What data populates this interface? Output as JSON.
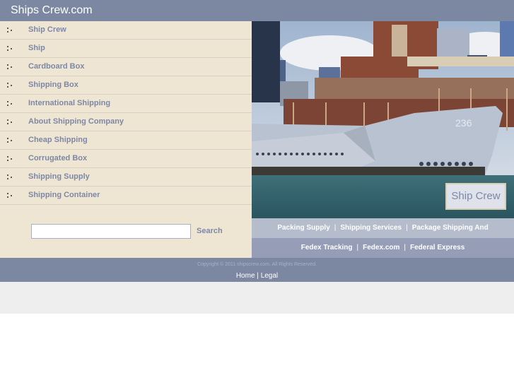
{
  "header": {
    "title": "Ships Crew.com"
  },
  "sidebar": {
    "items": [
      {
        "label": "Ship Crew"
      },
      {
        "label": "Ship"
      },
      {
        "label": "Cardboard Box"
      },
      {
        "label": "Shipping Box"
      },
      {
        "label": "International Shipping"
      },
      {
        "label": "About Shipping Company"
      },
      {
        "label": "Cheap Shipping"
      },
      {
        "label": "Corrugated Box"
      },
      {
        "label": "Shipping Supply"
      },
      {
        "label": "Shipping Container"
      }
    ],
    "bullet_icon": "dotted-bullet-icon",
    "search": {
      "value": "",
      "placeholder": "",
      "button_label": "Search"
    }
  },
  "photo": {
    "description": "Grey submarine with hull number 236 docked at a city pier",
    "hull_number": "236",
    "caption": "Ship Crew"
  },
  "related_links": {
    "row1": [
      "Packing Supply",
      "Shipping Services",
      "Package Shipping And"
    ],
    "row2": [
      "Fedex Tracking",
      "Fedex.com",
      "Federal Express"
    ],
    "separator": "|"
  },
  "footer": {
    "copyright": "Copyright © 2011 shipscrew.com. All Rights Reserved.",
    "links": [
      "Home",
      "Legal"
    ],
    "separator": "|"
  },
  "colors": {
    "header_bg": "#7c88a2",
    "sidebar_bg": "#efe5d3",
    "link_text": "#7d88a6",
    "links_row1_bg": "#b5bccb",
    "links_row2_bg": "#959eb6"
  }
}
